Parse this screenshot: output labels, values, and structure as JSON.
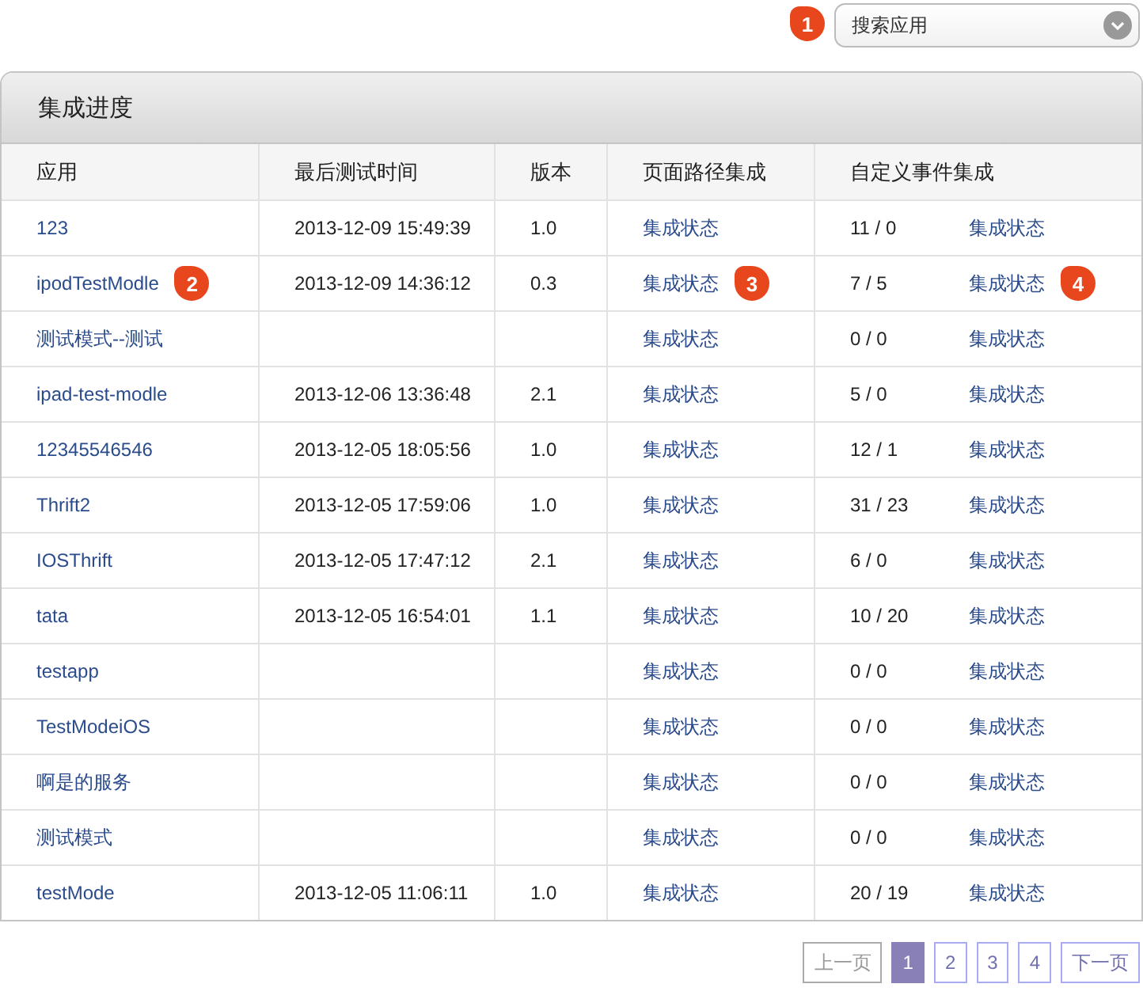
{
  "search": {
    "badge": "1",
    "placeholder": "搜索应用"
  },
  "panel": {
    "title": "集成进度",
    "columns": [
      "应用",
      "最后测试时间",
      "版本",
      "页面路径集成",
      "自定义事件集成"
    ],
    "rows": [
      {
        "app": "123",
        "time": "2013-12-09 15:49:39",
        "version": "1.0",
        "page_link": "集成状态",
        "counts": "11 / 0",
        "event_link": "集成状态"
      },
      {
        "app": "ipodTestModle",
        "app_badge": "2",
        "time": "2013-12-09 14:36:12",
        "version": "0.3",
        "page_link": "集成状态",
        "page_badge": "3",
        "counts": "7 / 5",
        "event_link": "集成状态",
        "event_badge": "4"
      },
      {
        "app": "测试模式--测试",
        "page_link": "集成状态",
        "counts": "0 / 0",
        "event_link": "集成状态"
      },
      {
        "app": "ipad-test-modle",
        "time": "2013-12-06 13:36:48",
        "version": "2.1",
        "page_link": "集成状态",
        "counts": "5 / 0",
        "event_link": "集成状态"
      },
      {
        "app": "12345546546",
        "time": "2013-12-05 18:05:56",
        "version": "1.0",
        "page_link": "集成状态",
        "counts": "12 / 1",
        "event_link": "集成状态"
      },
      {
        "app": "Thrift2",
        "time": "2013-12-05 17:59:06",
        "version": "1.0",
        "page_link": "集成状态",
        "counts": "31 / 23",
        "event_link": "集成状态"
      },
      {
        "app": "IOSThrift",
        "time": "2013-12-05 17:47:12",
        "version": "2.1",
        "page_link": "集成状态",
        "counts": "6 / 0",
        "event_link": "集成状态"
      },
      {
        "app": "tata",
        "time": "2013-12-05 16:54:01",
        "version": "1.1",
        "page_link": "集成状态",
        "counts": "10 / 20",
        "event_link": "集成状态"
      },
      {
        "app": "testapp",
        "page_link": "集成状态",
        "counts": "0 / 0",
        "event_link": "集成状态"
      },
      {
        "app": "TestModeiOS",
        "page_link": "集成状态",
        "counts": "0 / 0",
        "event_link": "集成状态"
      },
      {
        "app": "啊是的服务",
        "page_link": "集成状态",
        "counts": "0 / 0",
        "event_link": "集成状态"
      },
      {
        "app": "测试模式",
        "page_link": "集成状态",
        "counts": "0 / 0",
        "event_link": "集成状态"
      },
      {
        "app": "testMode",
        "time": "2013-12-05 11:06:11",
        "version": "1.0",
        "page_link": "集成状态",
        "counts": "20 / 19",
        "event_link": "集成状态"
      }
    ]
  },
  "pagination": {
    "prev": {
      "label": "上一页",
      "disabled": true
    },
    "pages": [
      {
        "label": "1",
        "selected": true
      },
      {
        "label": "2",
        "selected": false
      },
      {
        "label": "3",
        "selected": false
      },
      {
        "label": "4",
        "selected": false
      }
    ],
    "next": {
      "label": "下一页",
      "disabled": false
    }
  }
}
